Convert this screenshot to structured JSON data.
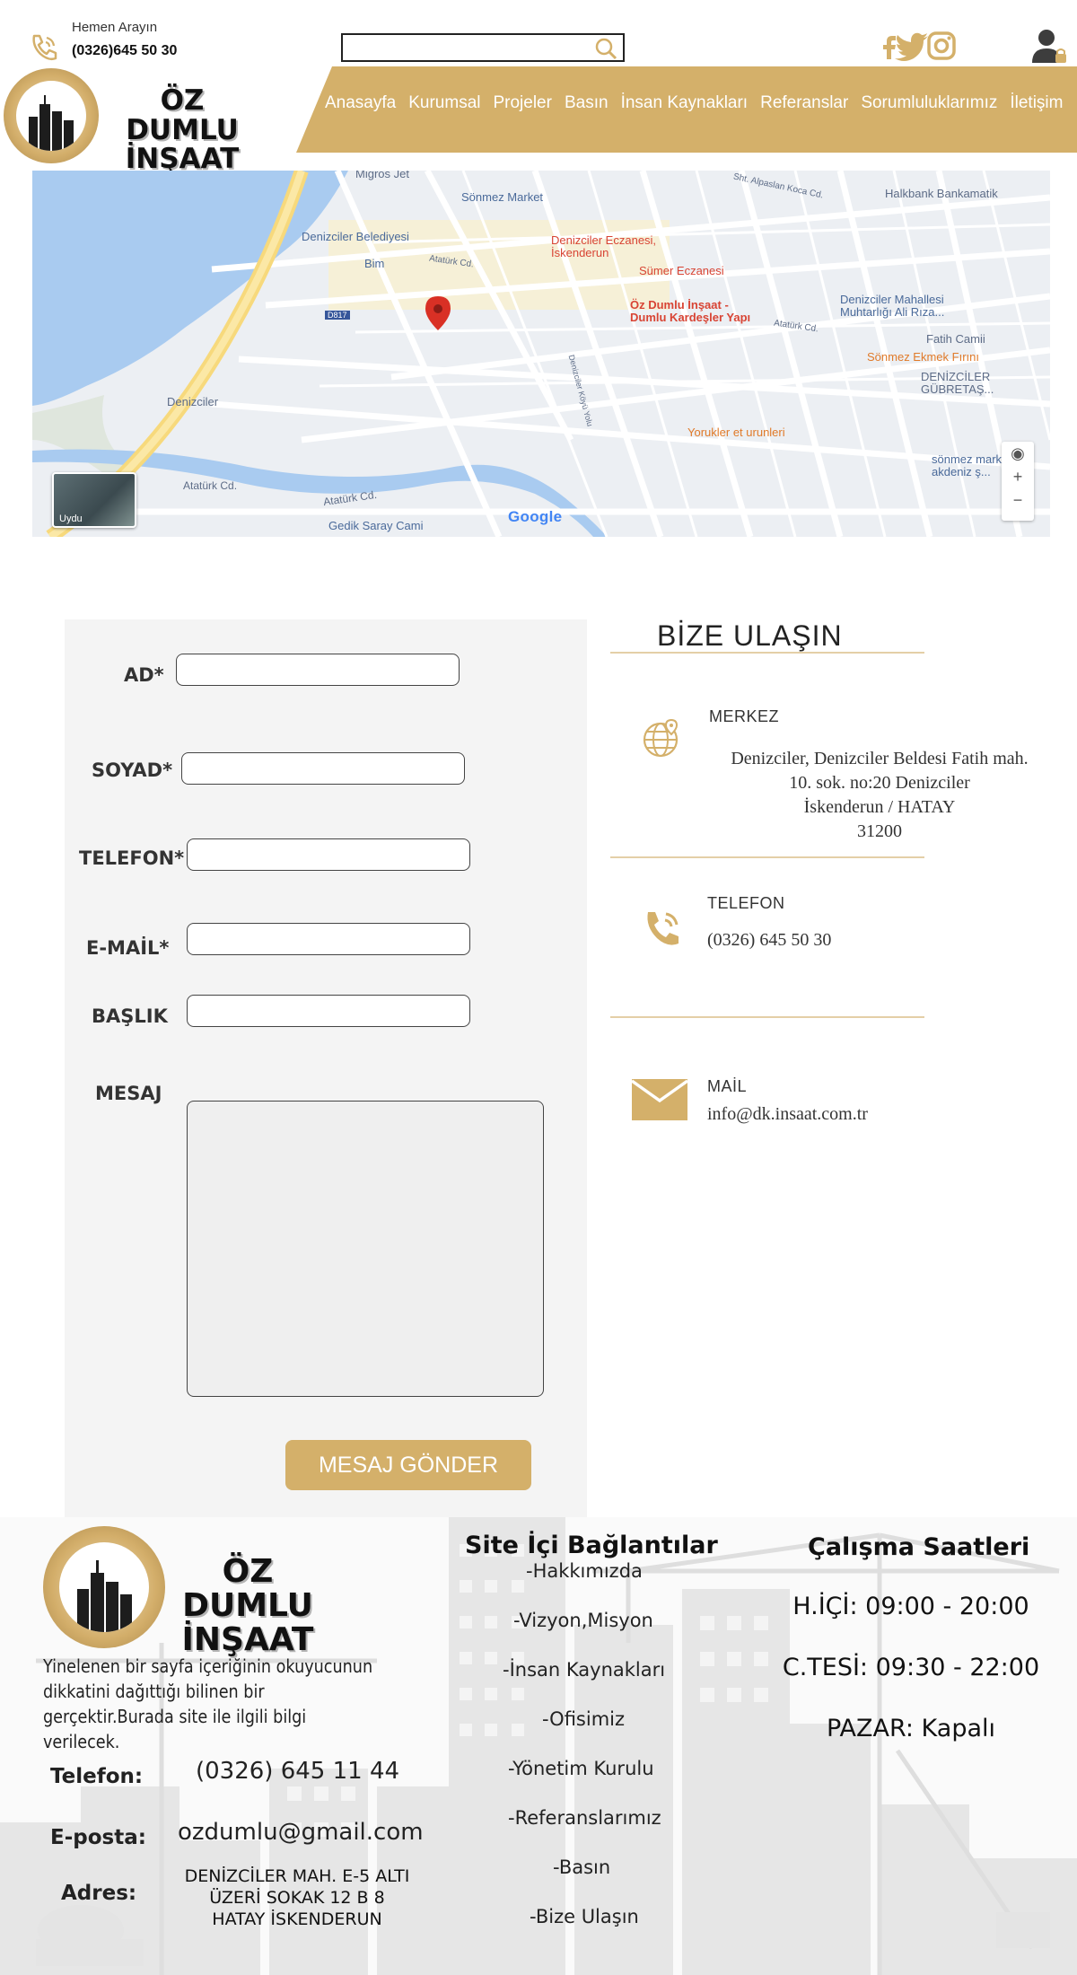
{
  "header": {
    "call_label": "Hemen Arayın",
    "call_number": "(0326)645 50 30",
    "search_placeholder": "",
    "logo_line1": "ÖZ DUMLU",
    "logo_line2": "İNŞAAT",
    "social": [
      "facebook-icon",
      "twitter-icon",
      "instagram-icon"
    ]
  },
  "nav": {
    "items": [
      "Anasayfa",
      "Kurumsal",
      "Projeler",
      "Basın",
      "İnsan Kaynakları",
      "Referanslar",
      "Sorumluluklarımız",
      "İletişim"
    ]
  },
  "map": {
    "labels": {
      "migros": "Migros Jet",
      "sonmez_market": "Sönmez Market",
      "halkbank": "Halkbank Bankamatik",
      "alpaslan": "Sht. Alpaslan Koca Cd.",
      "belediye": "Denizciler Belediyesi",
      "eczane1": "Denizciler Eczanesi,",
      "eczane1b": "İskenderun",
      "bim": "Bim",
      "ataturk1": "Atatürk Cd.",
      "sumer": "Sümer Eczanesi",
      "place_name": "Öz Dumlu İnşaat -",
      "place_name2": "Dumlu Kardeşler Yapı",
      "muhtar": "Denizciler Mahallesi",
      "muhtar2": "Muhtarlığı Ali Rıza...",
      "ataturk2": "Atatürk Cd.",
      "fatih": "Fatih Camii",
      "d817": "D817",
      "ekmek": "Sönmez Ekmek Fırını",
      "gubretas": "DENİZCİLER",
      "gubretas2": "GÜBRETAŞ...",
      "denizciler": "Denizciler",
      "yorukler": "Yorukler et urunleri",
      "sonmez_akdeniz": "sönmez market",
      "sonmez_akdeniz2": "akdeniz ş...",
      "ataturk3": "Atatürk Cd.",
      "ataturk4": "Atatürk Cd.",
      "gedik": "Gedik Saray Cami",
      "uydu": "Uydu",
      "google": "Google",
      "yolu": "Denizciler Köyü Yolu"
    }
  },
  "form": {
    "ad_label": "AD*",
    "soyad_label": "SOYAD*",
    "telefon_label": "TELEFON*",
    "email_label": "E-MAİL*",
    "baslik_label": "BAŞLIK",
    "mesaj_label": "MESAJ",
    "submit": "MESAJ GÖNDER"
  },
  "contact": {
    "title": "BİZE ULAŞIN",
    "merkez_head": "MERKEZ",
    "address_lines": [
      "Denizciler, Denizciler Beldesi Fatih mah.",
      "10. sok. no:20 Denizciler",
      "İskenderun / HATAY",
      "31200"
    ],
    "telefon_head": "TELEFON",
    "telefon": "(0326) 645 50 30",
    "mail_head": "MAİL",
    "mail": "info@dk.insaat.com.tr"
  },
  "footer": {
    "logo_line1": "ÖZ DUMLU",
    "logo_line2": "İNŞAAT",
    "description": "Yinelenen bir sayfa içeriğinin okuyucunun dikkatini dağıttığı bilinen bir gerçektir.Burada site ile ilgili  bilgi verilecek.",
    "telefon_label": "Telefon:",
    "telefon": "(0326) 645 11 44",
    "eposta_label": "E-posta:",
    "eposta": "ozdumlu@gmail.com",
    "adres_label": "Adres:",
    "adres_lines": [
      "DENİZCİLER MAH. E-5 ALTI",
      "ÜZERİ SOKAK 12 B 8",
      "HATAY İSKENDERUN"
    ],
    "links_title": "Site İçi Bağlantılar",
    "links": [
      "-Hakkımızda",
      "-Vizyon,Misyon",
      "-İnsan Kaynakları",
      "-Ofisimiz",
      "-Yönetim Kurulu",
      "-Referanslarımız",
      "-Basın",
      "-Bize Ulaşın"
    ],
    "hours_title": "Çalışma Saatleri",
    "hours": [
      "H.İÇİ: 09:00 - 20:00",
      "C.TESİ: 09:30 - 22:00",
      "PAZAR: Kapalı"
    ]
  },
  "colors": {
    "accent": "#d4b06a",
    "panel": "#f4f4f4",
    "rule": "#e4cfa7"
  }
}
